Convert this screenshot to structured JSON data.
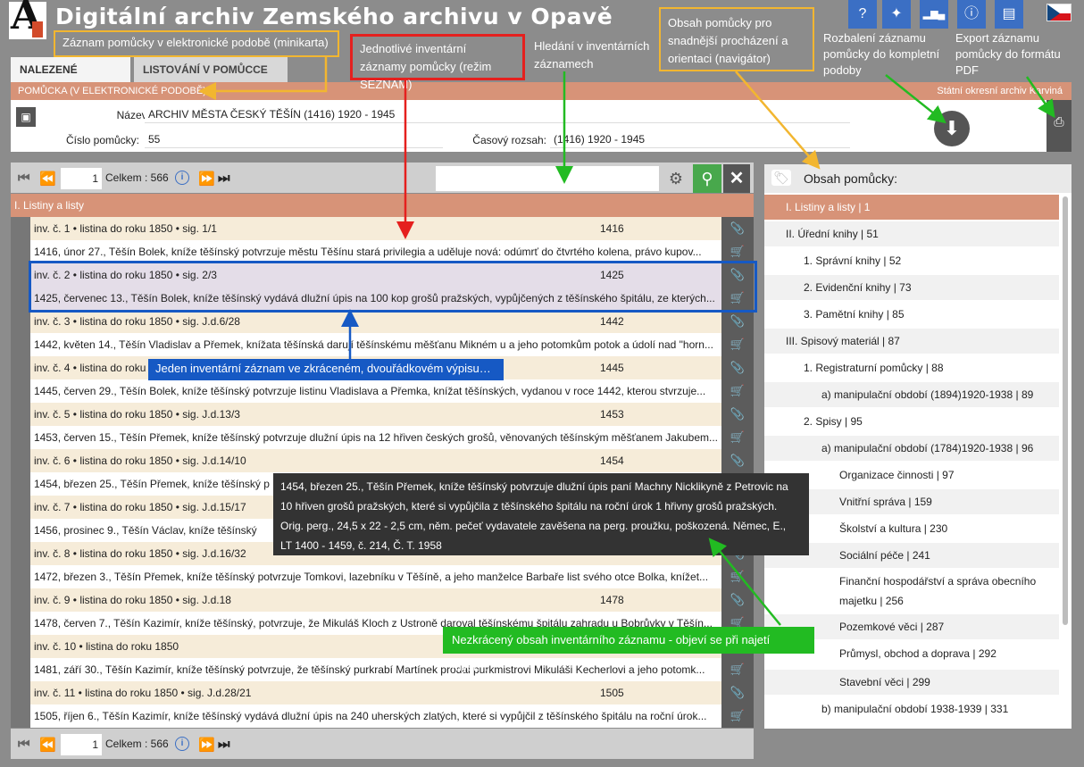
{
  "header": {
    "title": "Digitální archiv  Zemského archivu v Opavě",
    "buttons": [
      {
        "name": "help-icon",
        "glyph": "?"
      },
      {
        "name": "magic-wand-icon",
        "glyph": "✦"
      },
      {
        "name": "bar-chart-icon",
        "glyph": "▂▆▄"
      },
      {
        "name": "info-icon",
        "glyph": "i"
      },
      {
        "name": "print-icon",
        "glyph": "▤"
      }
    ]
  },
  "tabs": [
    {
      "label": "NALEZENÉ ZÁZNAMY"
    },
    {
      "label": "LISTOVÁNÍ V POMŮCCE",
      "close": "✕"
    }
  ],
  "band": {
    "left": "POMŮCKA (V ELEKTRONICKÉ PODOBĚ)",
    "right": "Státní okresní archiv Karviná"
  },
  "card": {
    "name_label": "Název:",
    "name_value": "ARCHIV MĚSTA ČESKÝ TĚŠÍN (1416) 1920 - 1945",
    "number_label": "Číslo pomůcky:",
    "number_value": "55",
    "range_label": "Časový rozsah:",
    "range_value": "(1416) 1920 - 1945"
  },
  "pager": {
    "page": "1",
    "total_label": "Celkem : 566"
  },
  "list": {
    "section": "I. Listiny a listy",
    "records": [
      {
        "head": "inv. č. 1 • listina do roku 1850 • sig. 1/1",
        "year": "1416",
        "text": "1416, únor 27., Těšín Bolek, kníže těšínský potvrzuje městu Těšínu stará privilegia a uděluje nová: odúmrť do čtvrtého kolena, právo kupov..."
      },
      {
        "head": "inv. č. 2 • listina do roku 1850 • sig. 2/3",
        "year": "1425",
        "text": "1425, červenec 13., Těšín Bolek, kníže těšínský vydává dlužní úpis na 100 kop grošů pražských, vypůjčených z těšínského špitálu, ze kterých..."
      },
      {
        "head": "inv. č. 3 • listina do roku 1850 • sig. J.d.6/28",
        "year": "1442",
        "text": "1442, květen 14., Těšín Vladislav a Přemek, knížata těšínská darují těšínskému měšťanu Mikném u a jeho potomkům potok a údolí nad \"horn..."
      },
      {
        "head": "inv. č. 4 • listina do roku 1850",
        "year": "1445",
        "text": "1445, červen 29., Těšín Bolek, kníže těšínský potvrzuje listinu Vladislava a Přemka, knížat těšínských, vydanou v roce 1442, kterou stvrzuje..."
      },
      {
        "head": "inv. č. 5 • listina do roku 1850 • sig. J.d.13/3",
        "year": "1453",
        "text": "1453, červen 15., Těšín Přemek, kníže těšínský potvrzuje dlužní úpis na 12 hřiven českých grošů, věnovaných těšínským měšťanem Jakubem..."
      },
      {
        "head": "inv. č. 6 • listina do roku 1850 • sig. J.d.14/10",
        "year": "1454",
        "text": "1454, březen 25., Těšín Přemek, kníže těšínský p"
      },
      {
        "head": "inv. č. 7 • listina do roku 1850 • sig. J.d.15/17",
        "year": "",
        "text": "1456, prosinec 9., Těšín Václav, kníže těšínský"
      },
      {
        "head": "inv. č. 8 • listina do roku 1850 • sig. J.d.16/32",
        "year": "",
        "text": "1472, březen 3., Těšín Přemek, kníže těšínský potvrzuje Tomkovi, lazebníku v Těšíně, a jeho manželce Barbaře list svého otce Bolka, knížet..."
      },
      {
        "head": "inv. č. 9 • listina do roku 1850 • sig. J.d.18",
        "year": "1478",
        "text": "1478, červen 7., Těšín Kazimír, kníže těšínský, potvrzuje, že Mikuláš Kloch z Ustroně daroval těšínskému špitálu zahradu u Bobrůvky v Těšín..."
      },
      {
        "head": "inv. č. 10 • listina do roku 1850",
        "year": "",
        "text": "1481, září 30., Těšín Kazimír, kníže těšínský potvrzuje, že těšínský purkrabí Martínek prodal purkmistrovi Mikuláši Kecherlovi a jeho potomk..."
      },
      {
        "head": "inv. č. 11 • listina do roku 1850 • sig. J.d.28/21",
        "year": "1505",
        "text": "1505, říjen 6., Těšín Kazimír, kníže těšínský vydává dlužní úpis na 240 uherských zlatých, které si vypůjčil z těšínského špitálu na roční úrok..."
      }
    ]
  },
  "tooltip": [
    "1454, březen 25., Těšín Přemek, kníže těšínský potvrzuje dlužní úpis paní Machny Nicklikyně z Petrovic na",
    "10 hřiven grošů pražských, které si vypůjčila z těšínského špitálu na roční úrok 1 hřivny grošů pražských.",
    "Orig. perg., 24,5 x 22 - 2,5 cm, něm. pečeť vydavatele zavěšena na perg. proužku, poškozená. Němec, E.,",
    "LT 1400 - 1459, č. 214, Č. T. 1958"
  ],
  "sidebar": {
    "title": "Obsah pomůcky:",
    "items": [
      {
        "label": "I. Listiny a listy | 1",
        "indent": 0
      },
      {
        "label": "II. Úřední knihy | 51",
        "indent": 0
      },
      {
        "label": "1. Správní knihy | 52",
        "indent": 1
      },
      {
        "label": "2. Evidenční knihy | 73",
        "indent": 1
      },
      {
        "label": "3. Pamětní knihy | 85",
        "indent": 1
      },
      {
        "label": "III. Spisový materiál | 87",
        "indent": 0
      },
      {
        "label": "1. Registraturní pomůcky | 88",
        "indent": 1
      },
      {
        "label": "a) manipulační období (1894)1920-1938 | 89",
        "indent": 2
      },
      {
        "label": "2. Spisy | 95",
        "indent": 1
      },
      {
        "label": "a) manipulační období (1784)1920-1938 | 96",
        "indent": 2
      },
      {
        "label": "Organizace činnosti | 97",
        "indent": 3
      },
      {
        "label": "Vnitřní správa | 159",
        "indent": 3
      },
      {
        "label": "Školství a kultura | 230",
        "indent": 3
      },
      {
        "label": "Sociální péče | 241",
        "indent": 3
      },
      {
        "label": "Finanční hospodářství a správa obecního majetku | 256",
        "indent": 3
      },
      {
        "label": "Pozemkové věci | 287",
        "indent": 3
      },
      {
        "label": "Průmysl, obchod a doprava | 292",
        "indent": 3
      },
      {
        "label": "Stavební věci | 299",
        "indent": 3
      },
      {
        "label": "b) manipulační období 1938-1939 | 331",
        "indent": 2
      }
    ]
  },
  "annotations": {
    "minikarta": "Záznam pomůcky v elektronické podobě (minikarta)",
    "seznam": "Jednotlivé inventární záznamy pomůcky (režim SEZNAM)",
    "hledani": "Hledání v inventárních záznamech",
    "navigator": "Obsah pomůcky pro snadnější procházení a orientaci (navigátor)",
    "rozbaleni": "Rozbalení záznamu pomůcky do kompletní podoby",
    "export": "Export záznamu pomůcky do formátu PDF",
    "jeden": "Jeden inventární záznam ve zkráceném, dvouřádkovém výpisu…",
    "nezkraceny": "Nezkrácený obsah inventárního záznamu - objeví se při najetí myší…"
  },
  "colors": {
    "accent": "#d79378",
    "blue": "#1659c4",
    "green": "#22bb22",
    "red": "#e5201e",
    "yellow": "#f2b630",
    "search_green": "#48a84c"
  }
}
